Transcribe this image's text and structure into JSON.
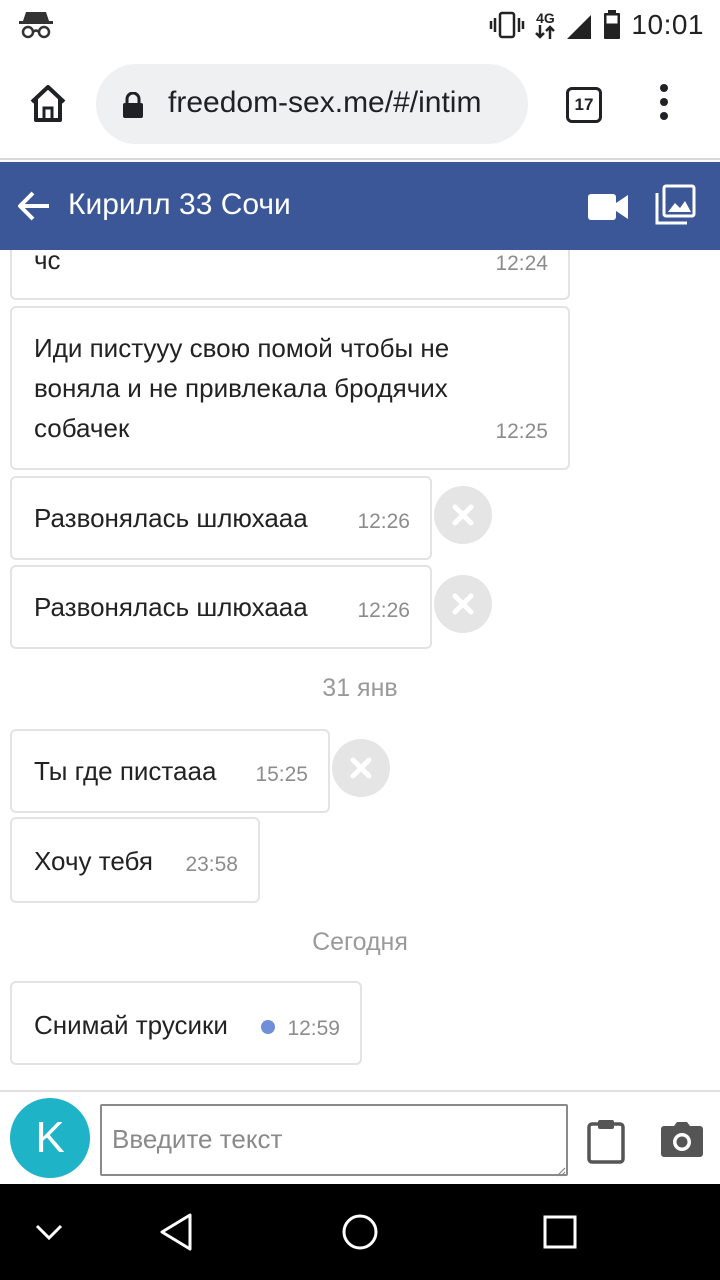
{
  "status_bar": {
    "time": "10:01",
    "network": "4G",
    "icons": [
      "incognito-icon",
      "vibrate-icon",
      "signal-icon",
      "battery-icon"
    ]
  },
  "browser": {
    "url": "freedom-sex.me/#/intim",
    "tab_count": "17",
    "icons": [
      "home-icon",
      "lock-icon",
      "more-vert-icon"
    ]
  },
  "header": {
    "title": "Кирилл 33 Сочи",
    "color": "#3b5797",
    "icons": [
      "back-arrow-icon",
      "video-call-icon",
      "gallery-icon"
    ]
  },
  "messages": [
    {
      "text": "чс",
      "time": "12:24",
      "deletable": false
    },
    {
      "text": "Иди пистууу свою помой чтобы не воняла и не привлекала бродячих собачек",
      "time": "12:25",
      "deletable": false
    },
    {
      "text": "Развонялась шлюхааа",
      "time": "12:26",
      "deletable": true
    },
    {
      "text": "Развонялась шлюхааа",
      "time": "12:26",
      "deletable": true
    },
    {
      "date_separator": "31 янв"
    },
    {
      "text": "Ты где пистааа",
      "time": "15:25",
      "deletable": true
    },
    {
      "text": "Хочу тебя",
      "time": "23:58",
      "deletable": false
    },
    {
      "date_separator": "Сегодня"
    },
    {
      "text": "Снимай трусики",
      "time": "12:59",
      "deletable": false,
      "unread": true
    }
  ],
  "composer": {
    "avatar_letter": "K",
    "avatar_color": "#1fb3c8",
    "placeholder": "Введите текст",
    "icons": [
      "clipboard-icon",
      "camera-icon"
    ]
  },
  "nav_bar": {
    "icons": [
      "collapse-icon",
      "back-triangle-icon",
      "home-circle-icon",
      "recents-square-icon"
    ]
  }
}
